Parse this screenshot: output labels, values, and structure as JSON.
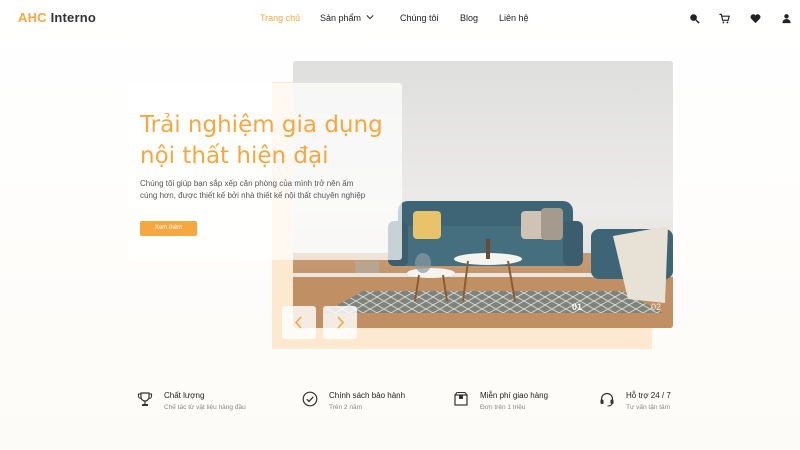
{
  "brand": {
    "part1": "AHC",
    "part2": "Interno"
  },
  "nav": {
    "items": [
      {
        "label": "Trang chủ",
        "active": true
      },
      {
        "label": "Sản phẩm",
        "has_dropdown": true
      },
      {
        "label": "Chúng tôi"
      },
      {
        "label": "Blog"
      },
      {
        "label": "Liên hệ"
      }
    ]
  },
  "header_icons": [
    "search-icon",
    "cart-icon",
    "heart-icon",
    "user-icon"
  ],
  "hero": {
    "title": "Trải nghiệm gia dụng nội thất hiện đại",
    "description": "Chúng tôi giúp bạn sắp xếp căn phòng của mình trở nên ấm cúng hơn, được thiết kế bởi nhà thiết kế nội thất chuyên nghiệp",
    "cta_label": "Xem thêm",
    "slides": [
      "01",
      "02"
    ]
  },
  "features": [
    {
      "icon": "trophy-icon",
      "title": "Chất lượng",
      "subtitle": "Chế tác từ vật liệu hàng đầu"
    },
    {
      "icon": "check-circle-icon",
      "title": "Chính sách bảo hành",
      "subtitle": "Trên 2 năm"
    },
    {
      "icon": "delivery-box-icon",
      "title": "Miễn phí giao hàng",
      "subtitle": "Đơn trên 1 triệu"
    },
    {
      "icon": "headset-icon",
      "title": "Hỗ trợ 24 / 7",
      "subtitle": "Tư vấn tận tâm"
    }
  ],
  "colors": {
    "accent": "#f6a740",
    "hero_bg": "#fde9cf",
    "text": "#222222"
  }
}
